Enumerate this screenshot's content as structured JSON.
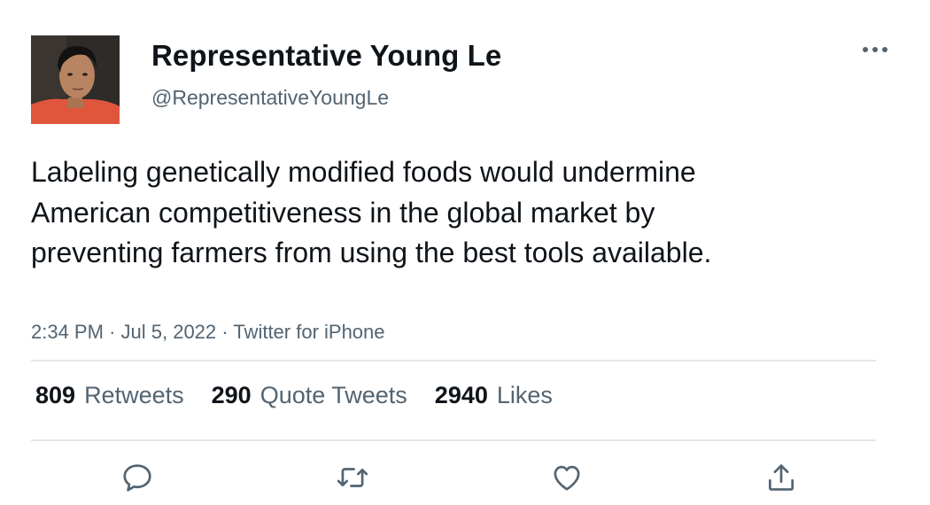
{
  "author": {
    "display_name": "Representative Young Le",
    "handle": "@RepresentativeYoungLe"
  },
  "tweet": {
    "text": "Labeling genetically modified foods would undermine American competitiveness in the global market by preventing farmers from using the best tools available.",
    "time": "2:34 PM",
    "date": "Jul 5, 2022",
    "source": "Twitter for iPhone",
    "separator": "·"
  },
  "stats": {
    "retweets": {
      "count": "809",
      "label": "Retweets"
    },
    "quotes": {
      "count": "290",
      "label": "Quote Tweets"
    },
    "likes": {
      "count": "2940",
      "label": "Likes"
    }
  },
  "icons": {
    "more": "more-horizontal-icon",
    "reply": "reply-icon",
    "retweet": "retweet-icon",
    "like": "heart-icon",
    "share": "share-icon"
  },
  "colors": {
    "text_primary": "#0f1419",
    "text_secondary": "#536471",
    "divider": "#e3e7ea"
  }
}
